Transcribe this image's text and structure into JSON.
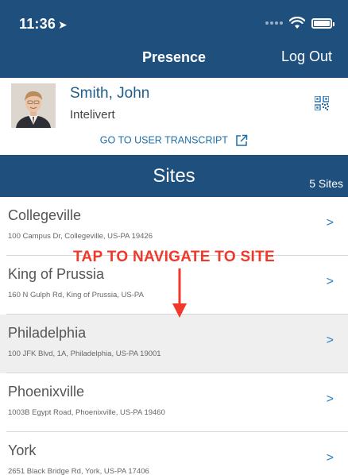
{
  "status_bar": {
    "time": "11:36",
    "location_icon": "location-arrow-icon",
    "wifi_icon": "wifi-icon",
    "battery_icon": "battery-icon"
  },
  "nav": {
    "title": "Presence",
    "logout_label": "Log Out"
  },
  "profile": {
    "name": "Smith, John",
    "organization": "Intelivert",
    "transcript_link": "GO TO USER TRANSCRIPT",
    "qr_icon": "qr-code-icon"
  },
  "sites": {
    "title": "Sites",
    "count_label": "5 Sites",
    "items": [
      {
        "name": "Collegeville",
        "address": "100 Campus Dr, Collegeville, US-PA 19426",
        "chevron": ">"
      },
      {
        "name": "King of Prussia",
        "address": "160 N Gulph Rd, King of Prussia, US-PA",
        "chevron": ">"
      },
      {
        "name": "Philadelphia",
        "address": "100 JFK Blvd, 1A, Philadelphia, US-PA 19001",
        "chevron": ">"
      },
      {
        "name": "Phoenixville",
        "address": "1003B Egypt Road, Phoenixville, US-PA 19460",
        "chevron": ">"
      },
      {
        "name": "York",
        "address": "2651 Black Bridge Rd, York, US-PA 17406",
        "chevron": ">"
      }
    ]
  },
  "annotation": {
    "text": "TAP TO NAVIGATE TO SITE",
    "color": "#f0382b"
  },
  "colors": {
    "header_bg": "#1e4f7d",
    "link": "#1f6fa8",
    "chevron": "#2a7fc0"
  }
}
